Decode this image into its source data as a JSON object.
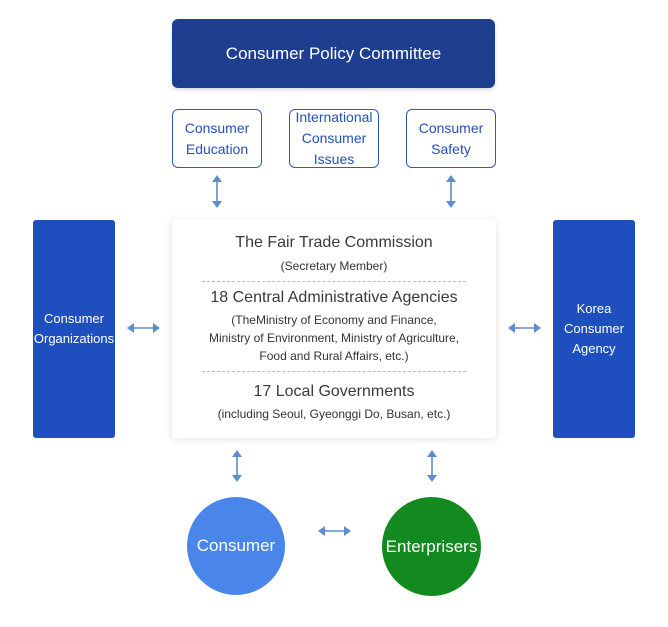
{
  "top": {
    "label": "Consumer Policy Committee"
  },
  "sub_boxes": [
    {
      "lines": [
        "Consumer",
        "Education"
      ]
    },
    {
      "lines": [
        "International",
        "Consumer",
        "Issues"
      ]
    },
    {
      "lines": [
        "Consumer",
        "Safety"
      ]
    }
  ],
  "left_box": {
    "lines": [
      "Consumer",
      "Organizations"
    ]
  },
  "right_box": {
    "lines": [
      "Korea",
      "Consumer",
      "Agency"
    ]
  },
  "center": {
    "section1": {
      "title": "The Fair Trade Commission",
      "sub": "(Secretary Member)"
    },
    "section2": {
      "title": "18 Central Administrative Agencies",
      "sub_lines": [
        "(TheMinistry of Economy and Finance,",
        "Ministry of Environment, Ministry of Agriculture,",
        "Food and Rural Affairs, etc.)"
      ]
    },
    "section3": {
      "title": "17 Local Governments",
      "sub": "(including Seoul, Gyeonggi Do, Busan, etc.)"
    }
  },
  "consumer": {
    "label": "Consumer",
    "color": "#4a86ea"
  },
  "enterprisers": {
    "label": "Enterprisers",
    "color": "#138a1f"
  },
  "colors": {
    "navy": "#1e3f8f",
    "blue": "#1f4fbf",
    "arrow": "#5f8dc9"
  }
}
